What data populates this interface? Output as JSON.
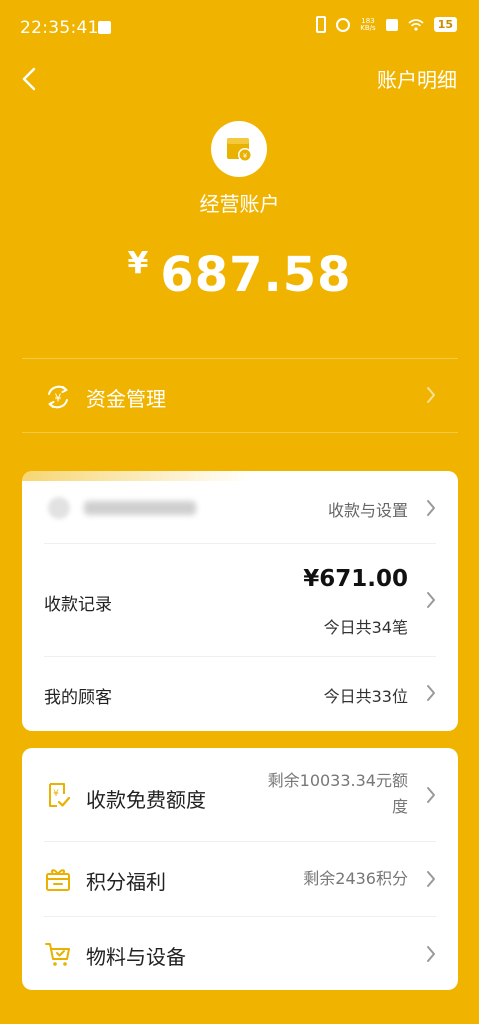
{
  "status_bar": {
    "time": "22:35:41",
    "net_speed_value": "183",
    "net_speed_unit": "KB/s",
    "battery": "15"
  },
  "header": {
    "detail_link": "账户明细"
  },
  "account": {
    "title": "经营账户",
    "currency": "¥",
    "balance": "687.58"
  },
  "fund_management": {
    "label": "资金管理"
  },
  "collection_card": {
    "settings_label": "收款与设置",
    "records": {
      "label": "收款记录",
      "amount": "¥671.00",
      "count_text": "今日共34笔"
    },
    "customers": {
      "label": "我的顾客",
      "count_text": "今日共33位"
    }
  },
  "features_card": {
    "items": [
      {
        "icon": "free-quota-icon",
        "label": "收款免费额度",
        "value_line1": "剩余10033.34元额",
        "value_line2": "度"
      },
      {
        "icon": "gift-icon",
        "label": "积分福利",
        "value": "剩余2436积分"
      },
      {
        "icon": "cart-icon",
        "label": "物料与设备"
      }
    ]
  },
  "colors": {
    "background": "#F0B400",
    "card": "#FFFFFF",
    "icon_accent": "#E9B100"
  }
}
